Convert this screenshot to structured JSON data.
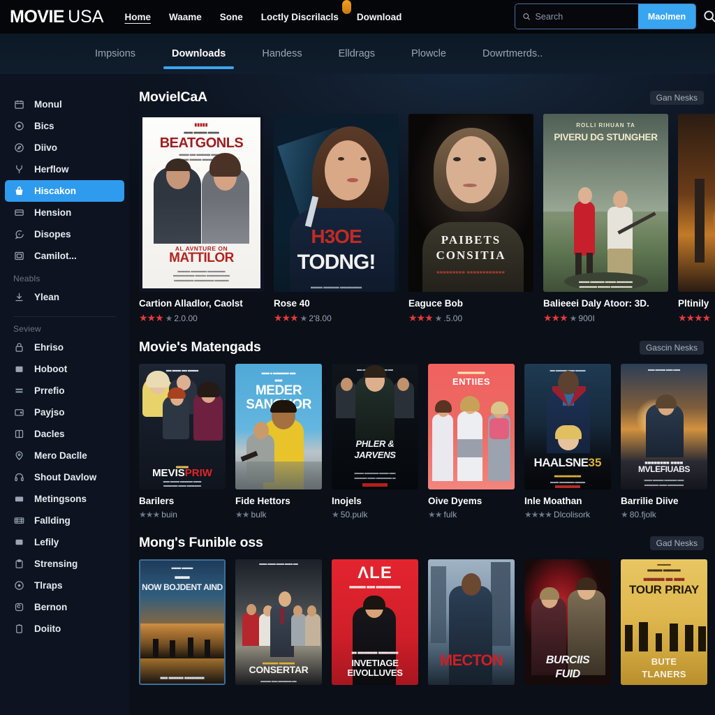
{
  "header": {
    "brand_bold": "MOVIE",
    "brand_light": "USA",
    "nav": [
      {
        "label": "Home",
        "active": true
      },
      {
        "label": "Waame",
        "active": false
      },
      {
        "label": "Sone",
        "active": false
      },
      {
        "label": "Loctly Discrilacls",
        "active": false
      },
      {
        "label": "Download",
        "active": false
      }
    ],
    "search": {
      "placeholder": "Search",
      "value": "",
      "button_label": "Maolmen"
    },
    "icons": {
      "search": "search-icon",
      "notification": "notification-badge-icon"
    }
  },
  "subnav": {
    "tabs": [
      {
        "label": "Impsions",
        "active": false
      },
      {
        "label": "Downloads",
        "active": true
      },
      {
        "label": "Handess",
        "active": false
      },
      {
        "label": "Elldrags",
        "active": false
      },
      {
        "label": "Plowcle",
        "active": false
      },
      {
        "label": "Dowrtmerds..",
        "active": false
      }
    ],
    "accent": "#3fa4f0"
  },
  "sidebar": {
    "primary": [
      {
        "label": "Monul",
        "icon": "calendar-icon",
        "active": false
      },
      {
        "label": "Bics",
        "icon": "disc-icon",
        "active": false
      },
      {
        "label": "Diivo",
        "icon": "compass-icon",
        "active": false
      },
      {
        "label": "Herflow",
        "icon": "branch-icon",
        "active": false
      },
      {
        "label": "Hiscakon",
        "icon": "basket-icon",
        "active": true
      },
      {
        "label": "Hension",
        "icon": "card-icon",
        "active": false
      },
      {
        "label": "Disopes",
        "icon": "chat-icon",
        "active": false
      },
      {
        "label": "Camilot...",
        "icon": "frame-icon",
        "active": false
      }
    ],
    "group_label_1": "Neabls",
    "group_1": [
      {
        "label": "Ylean",
        "icon": "download-icon",
        "active": false
      }
    ],
    "group_label_2": "Seview",
    "group_2": [
      {
        "label": "Ehriso",
        "icon": "lock-icon",
        "active": false
      },
      {
        "label": "Hoboot",
        "icon": "box-icon",
        "active": false
      },
      {
        "label": "Prrefio",
        "icon": "list-icon",
        "active": false
      },
      {
        "label": "Payjso",
        "icon": "wallet-icon",
        "active": false
      },
      {
        "label": "Dacles",
        "icon": "grid-icon",
        "active": false
      },
      {
        "label": "Mero Daclle",
        "icon": "pin-icon",
        "active": false
      },
      {
        "label": "Shout Davlow",
        "icon": "headset-icon",
        "active": false
      },
      {
        "label": "Metingsons",
        "icon": "window-icon",
        "active": false
      },
      {
        "label": "Fallding",
        "icon": "film-icon",
        "active": false
      },
      {
        "label": "Lefily",
        "icon": "square-icon",
        "active": false
      },
      {
        "label": "Strensing",
        "icon": "clipboard-icon",
        "active": false
      },
      {
        "label": "Tlraps",
        "icon": "target-icon",
        "active": false
      },
      {
        "label": "Bernon",
        "icon": "badge-icon",
        "active": false
      },
      {
        "label": "Doiito",
        "icon": "doc-icon",
        "active": false
      }
    ],
    "active_color": "#2f9bee"
  },
  "sections": [
    {
      "title": "MovielCaA",
      "more_label": "Gan Nesks",
      "cards": [
        {
          "title": "Cartion Alladlor, Caolst",
          "stars": 3,
          "rating": "2.0.00",
          "poster": "beatgonls"
        },
        {
          "title": "Rose 40",
          "stars": 3,
          "rating": "2'8.00",
          "poster": "hooe-todng"
        },
        {
          "title": "Eaguce Bob",
          "stars": 3,
          "rating": ".5.00",
          "poster": "paibets"
        },
        {
          "title": "Balieeei Daly Atoor: 3D.",
          "stars": 3,
          "rating": "900I",
          "poster": "piveru"
        },
        {
          "title": "Pltinily",
          "stars": 3,
          "rating": "",
          "poster": "sunset"
        }
      ]
    },
    {
      "title": "Movie's Matengads",
      "more_label": "Gascin Nesks",
      "cards": [
        {
          "title": "Barilers",
          "stars": 3,
          "rating": "buin",
          "poster": "mevis-priw"
        },
        {
          "title": "Fide Hettors",
          "stars": 2,
          "rating": "bulk",
          "poster": "meder-sanghor"
        },
        {
          "title": "Inojels",
          "stars": 1,
          "rating": "50.pulk",
          "poster": "pliler-jarvens"
        },
        {
          "title": "Oive Dyems",
          "stars": 2,
          "rating": "fulk",
          "poster": "entiies"
        },
        {
          "title": "Inle Moathan",
          "stars": 4,
          "rating": "Dlcolisork",
          "poster": "haalsne35"
        },
        {
          "title": "Barrilie Diive",
          "stars": 1,
          "rating": "80.fjolk",
          "poster": "mvlefiuabs"
        }
      ]
    },
    {
      "title": "Mong's Funible oss",
      "more_label": "Gad Nesks",
      "cards": [
        {
          "title": "",
          "stars": 0,
          "rating": "",
          "poster": "now-bojdent"
        },
        {
          "title": "",
          "stars": 0,
          "rating": "",
          "poster": "consertar"
        },
        {
          "title": "",
          "stars": 0,
          "rating": "",
          "poster": "invetiage"
        },
        {
          "title": "",
          "stars": 0,
          "rating": "",
          "poster": "mecton"
        },
        {
          "title": "",
          "stars": 0,
          "rating": "",
          "poster": "burciis-fuid"
        },
        {
          "title": "",
          "stars": 0,
          "rating": "",
          "poster": "tour-priay"
        }
      ]
    }
  ],
  "poster_text": {
    "beatgonls_top": "BEATGONLS",
    "beatgonls_main": "MATTILOR",
    "beatgonls_sub": "AL AVNTURE ON",
    "hooe": "H3OE",
    "todng": "TODNG!",
    "paibets_1": "PAIBETS",
    "paibets_2": "CONSITIA",
    "piveru_top": "ROLLI RIHUAN TA",
    "piveru_main": "PIVERU DG STUNGHER",
    "mevis": "MEVIS",
    "priw": "PRIW",
    "meder": "MEDER",
    "sanghor": "SANGHOR",
    "pliler": "PHLER &",
    "jarvens": "JARVENS",
    "entiies": "ENTIIES",
    "haalsne": "HAALSNE",
    "haalsne_num": "35",
    "mvlefiuabs": "MVLEFIUABS",
    "now_bojdent": "NOW BOJDENT AIND",
    "consertar": "CONSERTAR",
    "invetiage": "INVETIAGE",
    "eivolluves": "EIVOLLUVES",
    "mecton": "MECTON",
    "burciis": "BURCIIS",
    "fuid": "FUID",
    "tour_priay": "TOUR PRIAY",
    "bute": "BUTE",
    "tlaners": "TLANERS"
  }
}
